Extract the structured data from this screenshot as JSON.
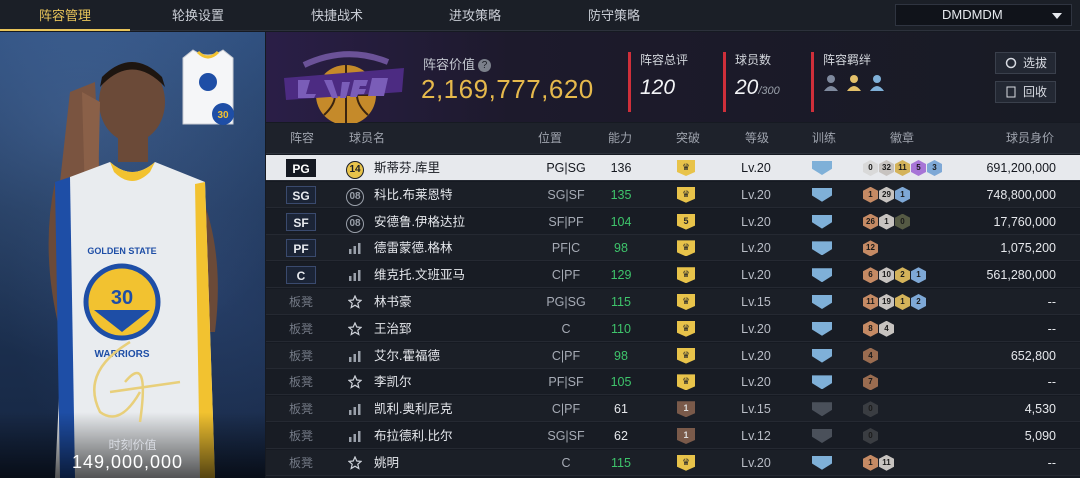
{
  "nav": {
    "tabs": [
      "阵容管理",
      "轮换设置",
      "快捷战术",
      "进攻策略",
      "防守策略"
    ],
    "active_tab": "阵容管理",
    "account": "DMDMDM"
  },
  "featured": {
    "jersey_number": "30",
    "moment_label": "时刻价值",
    "moment_value": "149,000,000"
  },
  "header": {
    "team_value_label": "阵容价值",
    "team_value": "2,169,777,620",
    "overall_label": "阵容总评",
    "overall": "120",
    "count_label": "球员数",
    "count": "20",
    "count_max": "/300",
    "bond_label": "阵容羁绊",
    "select_label": "选拔",
    "back_label": "回收"
  },
  "colors": {
    "accent": "#e8c45a",
    "value": "#e6b94c",
    "green": "#3ec46b",
    "stat_bar": "#cf2f3a"
  },
  "table": {
    "headers": [
      "阵容",
      "球员名",
      "位置",
      "能力",
      "突破",
      "等级",
      "训练",
      "徽章",
      "球员身价"
    ],
    "rows": [
      {
        "slot": "PG",
        "name": "斯蒂芬.库里",
        "pos": "PG|SG",
        "rating": "136",
        "rating_color": "w",
        "breakthrough": "crown",
        "level": "Lv.20",
        "badges": [
          [
            "0",
            "#d9d9d9"
          ],
          [
            "32",
            "#c7c3c0"
          ],
          [
            "11",
            "#d4b35a"
          ],
          [
            "5",
            "#a775d6"
          ],
          [
            "3",
            "#7ea8d6"
          ]
        ],
        "price": "691,200,000",
        "icon": "14"
      },
      {
        "slot": "SG",
        "name": "科比.布莱恩特",
        "pos": "SG|SF",
        "rating": "135",
        "rating_color": "g",
        "breakthrough": "crown",
        "level": "Lv.20",
        "badges": [
          [
            "1",
            "#c58a64"
          ],
          [
            "29",
            "#c7c3c0"
          ],
          [
            "1",
            "#7ea8d6"
          ]
        ],
        "price": "748,800,000",
        "icon": "08"
      },
      {
        "slot": "SF",
        "name": "安德鲁.伊格达拉",
        "pos": "SF|PF",
        "rating": "104",
        "rating_color": "g",
        "breakthrough": "5",
        "level": "Lv.20",
        "badges": [
          [
            "26",
            "#c58a64"
          ],
          [
            "1",
            "#c7c3c0"
          ],
          [
            "0",
            "#555a44"
          ]
        ],
        "price": "17,760,000",
        "icon": "08"
      },
      {
        "slot": "PF",
        "name": "德雷蒙德.格林",
        "pos": "PF|C",
        "rating": "98",
        "rating_color": "g",
        "breakthrough": "crown",
        "level": "Lv.20",
        "badges": [
          [
            "12",
            "#c58a64"
          ]
        ],
        "price": "1,075,200",
        "icon": "bars"
      },
      {
        "slot": "C",
        "name": "维克托.文班亚马",
        "pos": "C|PF",
        "rating": "129",
        "rating_color": "g",
        "breakthrough": "crown",
        "level": "Lv.20",
        "badges": [
          [
            "6",
            "#c58a64"
          ],
          [
            "10",
            "#c7c3c0"
          ],
          [
            "2",
            "#d4b35a"
          ],
          [
            "1",
            "#7ea8d6"
          ]
        ],
        "price": "561,280,000",
        "icon": "bars"
      },
      {
        "slot": "板凳",
        "name": "林书豪",
        "pos": "PG|SG",
        "rating": "115",
        "rating_color": "g",
        "breakthrough": "crown",
        "level": "Lv.15",
        "badges": [
          [
            "11",
            "#c58a64"
          ],
          [
            "19",
            "#c7c3c0"
          ],
          [
            "1",
            "#d4b35a"
          ],
          [
            "2",
            "#7ea8d6"
          ]
        ],
        "price": "--",
        "icon": "star"
      },
      {
        "slot": "板凳",
        "name": "王治郅",
        "pos": "C",
        "rating": "110",
        "rating_color": "g",
        "breakthrough": "crown",
        "level": "Lv.20",
        "badges": [
          [
            "8",
            "#c58a64"
          ],
          [
            "4",
            "#c7c3c0"
          ]
        ],
        "price": "--",
        "icon": "star"
      },
      {
        "slot": "板凳",
        "name": "艾尔.霍福德",
        "pos": "C|PF",
        "rating": "98",
        "rating_color": "g",
        "breakthrough": "crown",
        "level": "Lv.20",
        "badges": [
          [
            "4",
            "#9a6c50"
          ]
        ],
        "price": "652,800",
        "icon": "bars"
      },
      {
        "slot": "板凳",
        "name": "李凯尔",
        "pos": "PF|SF",
        "rating": "105",
        "rating_color": "g",
        "breakthrough": "crown",
        "level": "Lv.20",
        "badges": [
          [
            "7",
            "#9a6c50"
          ]
        ],
        "price": "--",
        "icon": "star"
      },
      {
        "slot": "板凳",
        "name": "凯利.奥利尼克",
        "pos": "C|PF",
        "rating": "61",
        "rating_color": "w",
        "breakthrough": "1",
        "level": "Lv.15",
        "badges": [
          [
            "0",
            "#3a3d42"
          ]
        ],
        "price": "4,530",
        "icon": "bars"
      },
      {
        "slot": "板凳",
        "name": "布拉德利.比尔",
        "pos": "SG|SF",
        "rating": "62",
        "rating_color": "w",
        "breakthrough": "1",
        "level": "Lv.12",
        "badges": [
          [
            "0",
            "#3a3d42"
          ]
        ],
        "price": "5,090",
        "icon": "bars"
      },
      {
        "slot": "板凳",
        "name": "姚明",
        "pos": "C",
        "rating": "115",
        "rating_color": "g",
        "breakthrough": "crown",
        "level": "Lv.20",
        "badges": [
          [
            "1",
            "#c58a64"
          ],
          [
            "11",
            "#c7c3c0"
          ]
        ],
        "price": "--",
        "icon": "star"
      }
    ]
  }
}
